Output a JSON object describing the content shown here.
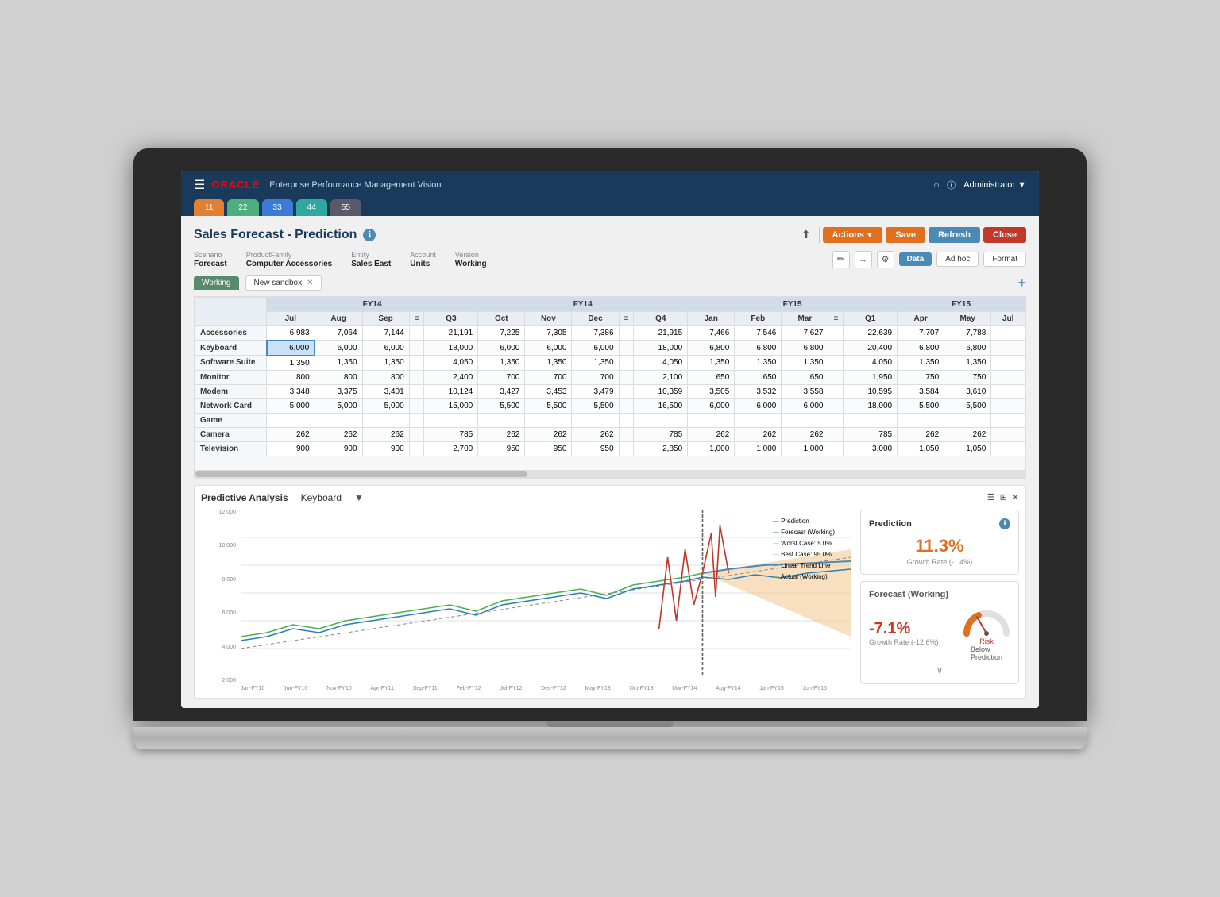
{
  "laptop": {
    "nav_tabs": [
      {
        "label": "11",
        "style": "orange"
      },
      {
        "label": "22",
        "style": "green"
      },
      {
        "label": "33",
        "style": "blue"
      },
      {
        "label": "44",
        "style": "teal"
      },
      {
        "label": "55",
        "style": "dark"
      }
    ]
  },
  "app": {
    "topbar_title": "Enterprise Performance Management  Vision",
    "oracle_text": "ORACLE",
    "admin_text": "Administrator ▼"
  },
  "page": {
    "title": "Sales Forecast - Prediction",
    "info_icon": "ℹ",
    "export_icon": "⬆"
  },
  "buttons": {
    "actions": "Actions",
    "save": "Save",
    "refresh": "Refresh",
    "close": "Close",
    "data": "Data",
    "adhoc": "Ad hoc",
    "format": "Format"
  },
  "filters": {
    "scenario_label": "Scenario",
    "scenario_value": "Forecast",
    "product_family_label": "ProductFamily",
    "product_family_value": "Computer Accessories",
    "entity_label": "Entity",
    "entity_value": "Sales East",
    "account_label": "Account",
    "account_value": "Units",
    "version_label": "Version",
    "version_value": "Working"
  },
  "working_tab": {
    "label": "Working",
    "sandbox_label": "New sandbox",
    "add_label": "+"
  },
  "table": {
    "fy14_group": "FY14",
    "fy15_group": "FY15",
    "columns": [
      "",
      "Jul",
      "Aug",
      "Sep",
      "≡",
      "Q3",
      "Oct",
      "Nov",
      "Dec",
      "≡",
      "Q4",
      "Jan",
      "Feb",
      "Mar",
      "≡",
      "Q1",
      "Apr",
      "May",
      "Jul"
    ],
    "rows": [
      {
        "name": "Accessories",
        "values": [
          "6,983",
          "7,064",
          "7,144",
          "",
          "21,191",
          "7,225",
          "7,305",
          "7,386",
          "",
          "21,915",
          "7,466",
          "7,546",
          "7,627",
          "",
          "22,639",
          "7,707",
          "7,788",
          ""
        ]
      },
      {
        "name": "Keyboard",
        "values": [
          "6,000",
          "6,000",
          "6,000",
          "",
          "18,000",
          "6,000",
          "6,000",
          "6,000",
          "",
          "18,000",
          "6,800",
          "6,800",
          "6,800",
          "",
          "20,400",
          "6,800",
          "6,800",
          ""
        ],
        "selected_col": 0
      },
      {
        "name": "Software Suite",
        "values": [
          "1,350",
          "1,350",
          "1,350",
          "",
          "4,050",
          "1,350",
          "1,350",
          "1,350",
          "",
          "4,050",
          "1,350",
          "1,350",
          "1,350",
          "",
          "4,050",
          "1,350",
          "1,350",
          ""
        ]
      },
      {
        "name": "Monitor",
        "values": [
          "800",
          "800",
          "800",
          "",
          "2,400",
          "700",
          "700",
          "700",
          "",
          "2,100",
          "650",
          "650",
          "650",
          "",
          "1,950",
          "750",
          "750",
          ""
        ]
      },
      {
        "name": "Modem",
        "values": [
          "3,348",
          "3,375",
          "3,401",
          "",
          "10,124",
          "3,427",
          "3,453",
          "3,479",
          "",
          "10,359",
          "3,505",
          "3,532",
          "3,558",
          "",
          "10,595",
          "3,584",
          "3,610",
          ""
        ]
      },
      {
        "name": "Network Card",
        "values": [
          "5,000",
          "5,000",
          "5,000",
          "",
          "15,000",
          "5,500",
          "5,500",
          "5,500",
          "",
          "16,500",
          "6,000",
          "6,000",
          "6,000",
          "",
          "18,000",
          "5,500",
          "5,500",
          ""
        ]
      },
      {
        "name": "Game",
        "values": [
          "",
          "",
          "",
          "",
          "",
          "",
          "",
          "",
          "",
          "",
          "",
          "",
          "",
          "",
          "",
          "",
          "",
          ""
        ]
      },
      {
        "name": "Camera",
        "values": [
          "262",
          "262",
          "262",
          "",
          "785",
          "262",
          "262",
          "262",
          "",
          "785",
          "262",
          "262",
          "262",
          "",
          "785",
          "262",
          "262",
          ""
        ]
      },
      {
        "name": "Television",
        "values": [
          "900",
          "900",
          "900",
          "",
          "2,700",
          "950",
          "950",
          "950",
          "",
          "2,850",
          "1,000",
          "1,000",
          "1,000",
          "",
          "3,000",
          "1,050",
          "1,050",
          ""
        ]
      }
    ]
  },
  "bottom_panel": {
    "title": "Predictive Analysis",
    "subtitle": "Keyboard",
    "dropdown_icon": "▼"
  },
  "chart": {
    "y_labels": [
      "12,000",
      "10,000",
      "8,000",
      "6,000",
      "4,000",
      "2,000"
    ],
    "x_labels": [
      "Jan-FY10",
      "Jun-FY10",
      "Nov-FY10",
      "Apr-FY11",
      "Sep-FY11",
      "Feb-FY12",
      "Jul-FY12",
      "Dec-FY12",
      "May-FY13",
      "Oct-FY13",
      "Mar-FY14",
      "Aug-FY14",
      "Jan-FY15",
      "Jun-FY15"
    ],
    "legend": [
      {
        "label": "— Prediction",
        "color": "#c0392b"
      },
      {
        "label": "— Forecast (Working)",
        "color": "#2980b9"
      },
      {
        "label": "— Worst Case: 5.0%",
        "color": "#aaa"
      },
      {
        "label": "— Best Case: 95.0%",
        "color": "#aaa"
      },
      {
        "label": "— Linear Trend Line",
        "color": "#888"
      },
      {
        "label": "— Actual (Working)",
        "color": "#4caf50"
      }
    ]
  },
  "prediction_card": {
    "title": "Prediction",
    "info_icon": "ℹ",
    "value": "11.3%",
    "sub_label": "Growth Rate (-1.4%)"
  },
  "forecast_card": {
    "title": "Forecast (Working)",
    "value": "-7.1%",
    "sub_label": "Growth Rate (-12.6%)",
    "risk_label": "Risk",
    "below_pred_label": "Below\nPrediction",
    "chevron": "∨"
  }
}
